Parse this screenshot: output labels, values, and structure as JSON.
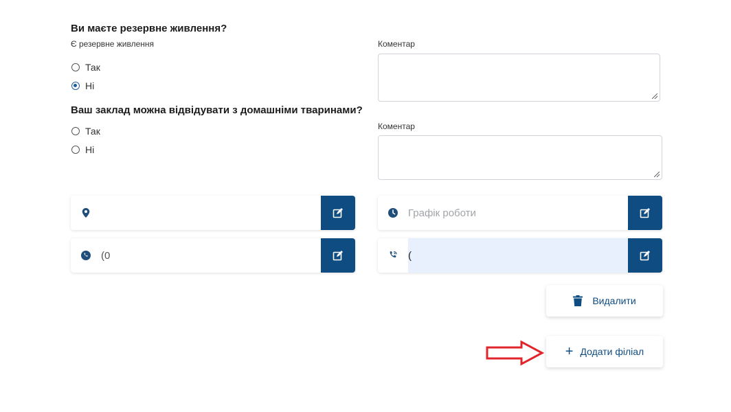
{
  "section1": {
    "title": "Ви маєте резервне живлення?",
    "field_label": "Є резервне живлення",
    "options": [
      {
        "label": "Так",
        "checked": false
      },
      {
        "label": "Ні",
        "checked": true
      }
    ],
    "comment_label": "Коментар",
    "comment_value": ""
  },
  "section2": {
    "title": "Ваш заклад можна відвідувати з домашніми тваринами?",
    "options": [
      {
        "label": "Так",
        "checked": false
      },
      {
        "label": "Ні",
        "checked": false
      }
    ],
    "comment_label": "Коментар",
    "comment_value": ""
  },
  "fields": {
    "address": {
      "icon": "map-marker-icon",
      "value": ""
    },
    "schedule": {
      "icon": "clock-icon",
      "placeholder": "Графік роботи"
    },
    "phone": {
      "icon": "phone-icon",
      "value": "(0"
    },
    "phone2": {
      "icon": "phone-call-icon",
      "value": "("
    }
  },
  "actions": {
    "delete_label": "Видалити",
    "add_branch_label": "Додати філіал",
    "add_icon": "+"
  },
  "colors": {
    "primary": "#0f4c81",
    "annotation_arrow": "#e0262b",
    "active_field_bg": "#e8f0fe"
  }
}
